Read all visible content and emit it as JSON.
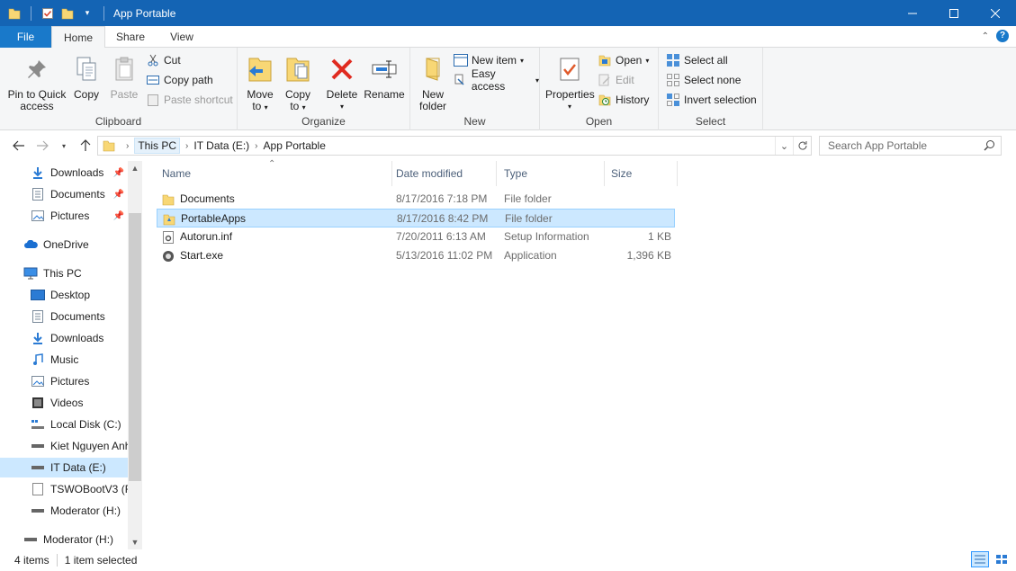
{
  "window": {
    "title": "App Portable"
  },
  "ribbon_tabs": {
    "file": "File",
    "home": "Home",
    "share": "Share",
    "view": "View"
  },
  "clipboard": {
    "pin_label_1": "Pin to Quick",
    "pin_label_2": "access",
    "copy": "Copy",
    "paste": "Paste",
    "cut": "Cut",
    "copy_path": "Copy path",
    "paste_shortcut": "Paste shortcut",
    "group": "Clipboard"
  },
  "organize": {
    "move_to_1": "Move",
    "move_to_2": "to",
    "copy_to_1": "Copy",
    "copy_to_2": "to",
    "delete": "Delete",
    "rename": "Rename",
    "group": "Organize"
  },
  "new": {
    "new_folder_1": "New",
    "new_folder_2": "folder",
    "new_item": "New item",
    "easy_access": "Easy access",
    "group": "New"
  },
  "open": {
    "properties": "Properties",
    "open": "Open",
    "edit": "Edit",
    "history": "History",
    "group": "Open"
  },
  "select": {
    "select_all": "Select all",
    "select_none": "Select none",
    "invert_selection": "Invert selection",
    "group": "Select"
  },
  "address": {
    "crumbs": [
      "This PC",
      "IT Data (E:)",
      "App Portable"
    ]
  },
  "search": {
    "placeholder": "Search App Portable"
  },
  "nav": [
    {
      "label": "Downloads",
      "icon": "download-icon",
      "pinned": true
    },
    {
      "label": "Documents",
      "icon": "document-icon",
      "pinned": true
    },
    {
      "label": "Pictures",
      "icon": "pictures-icon",
      "pinned": true
    },
    {
      "label": "OneDrive",
      "icon": "cloud-icon"
    },
    {
      "label": "This PC",
      "icon": "computer-icon"
    },
    {
      "label": "Desktop",
      "icon": "desktop-icon"
    },
    {
      "label": "Documents",
      "icon": "document-icon"
    },
    {
      "label": "Downloads",
      "icon": "download-icon"
    },
    {
      "label": "Music",
      "icon": "music-icon"
    },
    {
      "label": "Pictures",
      "icon": "pictures-icon"
    },
    {
      "label": "Videos",
      "icon": "video-icon"
    },
    {
      "label": "Local Disk (C:)",
      "icon": "system-drive-icon"
    },
    {
      "label": "Kiet Nguyen Anh",
      "icon": "drive-icon"
    },
    {
      "label": "IT Data (E:)",
      "icon": "drive-icon",
      "selected": true
    },
    {
      "label": "TSWOBootV3 (F:",
      "icon": "removable-drive-icon"
    },
    {
      "label": "Moderator (H:)",
      "icon": "drive-icon"
    },
    {
      "label": "Moderator (H:)",
      "icon": "drive-icon"
    }
  ],
  "columns": {
    "name": "Name",
    "date": "Date modified",
    "type": "Type",
    "size": "Size"
  },
  "files": [
    {
      "name": "Documents",
      "date": "8/17/2016 7:18 PM",
      "type": "File folder",
      "size": "",
      "icon": "folder-icon"
    },
    {
      "name": "PortableApps",
      "date": "8/17/2016 8:42 PM",
      "type": "File folder",
      "size": "",
      "icon": "folder-icon",
      "selected": true
    },
    {
      "name": "Autorun.inf",
      "date": "7/20/2011 6:13 AM",
      "type": "Setup Information",
      "size": "1 KB",
      "icon": "settings-file-icon"
    },
    {
      "name": "Start.exe",
      "date": "5/13/2016 11:02 PM",
      "type": "Application",
      "size": "1,396 KB",
      "icon": "application-icon"
    }
  ],
  "status": {
    "count": "4 items",
    "selected": "1 item selected"
  },
  "colors": {
    "titlebar": "#1464b4",
    "file_tab": "#1979ca",
    "selection": "#cce8ff"
  }
}
